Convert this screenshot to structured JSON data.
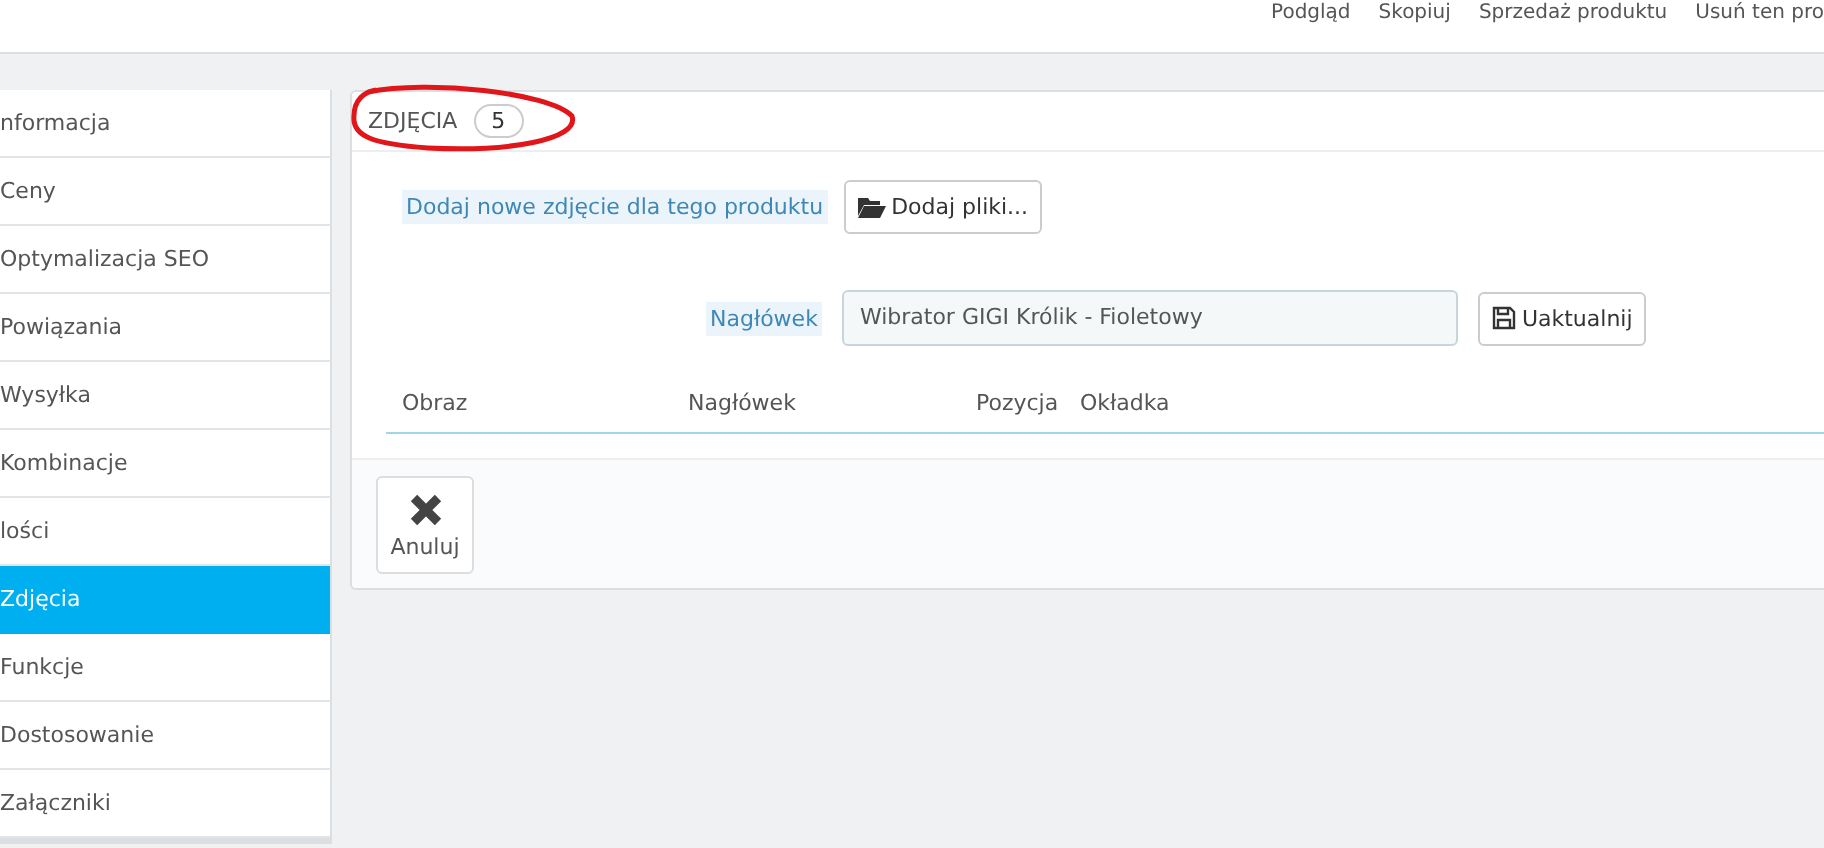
{
  "top_actions": [
    "Podgląd",
    "Skopiuj",
    "Sprzedaż produktu",
    "Usuń ten pro"
  ],
  "sidebar": {
    "items": [
      {
        "label": "nformacja",
        "selected": false
      },
      {
        "label": "Ceny",
        "selected": false
      },
      {
        "label": "Optymalizacja SEO",
        "selected": false
      },
      {
        "label": "Powiązania",
        "selected": false
      },
      {
        "label": "Wysyłka",
        "selected": false
      },
      {
        "label": "Kombinacje",
        "selected": false
      },
      {
        "label": "lości",
        "selected": false
      },
      {
        "label": "Zdjęcia",
        "selected": true
      },
      {
        "label": "Funkcje",
        "selected": false
      },
      {
        "label": "Dostosowanie",
        "selected": false
      },
      {
        "label": "Załączniki",
        "selected": false
      }
    ]
  },
  "panel": {
    "title": "ZDJĘCIA",
    "count": "5",
    "circled": true,
    "upload_label": "Dodaj nowe zdjęcie dla tego produktu",
    "upload_button": "Dodaj pliki...",
    "caption_label": "Nagłówek",
    "caption_value": "Wibrator GIGI Królik - Fioletowy",
    "update_button": "Uaktualnij",
    "table": {
      "columns": [
        "Obraz",
        "Nagłówek",
        "Pozycja",
        "Okładka"
      ]
    },
    "cancel_button": "Anuluj"
  }
}
